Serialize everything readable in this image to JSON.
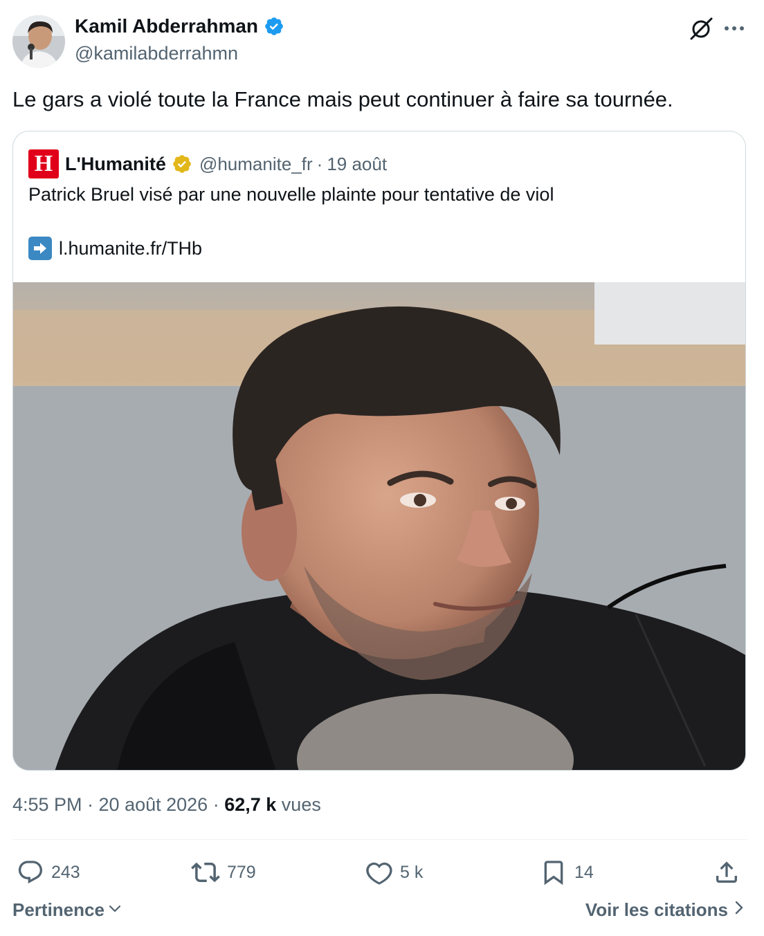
{
  "author": {
    "name": "Kamil Abderrahman",
    "handle": "@kamilabderrahmn",
    "verified_color": "#1d9bf0"
  },
  "tweet": {
    "text": "Le gars a violé toute la France mais peut continuer à faire sa tournée."
  },
  "quoted": {
    "logo_letter": "H",
    "logo_color": "#e1001a",
    "name": "L'Humanité",
    "badge_color": "#e2b719",
    "handle": "@humanite_fr",
    "separator": "·",
    "date": "19 août",
    "text": "Patrick Bruel visé par une nouvelle plainte pour tentative de viol",
    "link": "l.humanite.fr/THb",
    "image_icon": "photo"
  },
  "meta": {
    "timestamp": "4:55 PM · 20 août 2026 ·",
    "views_count": "62,7 k",
    "views_label": "vues"
  },
  "actions": {
    "replies": "243",
    "reposts": "779",
    "likes": "5 k",
    "bookmarks": "14"
  },
  "footer": {
    "sort_label": "Pertinence",
    "quotes_label": "Voir les citations"
  }
}
